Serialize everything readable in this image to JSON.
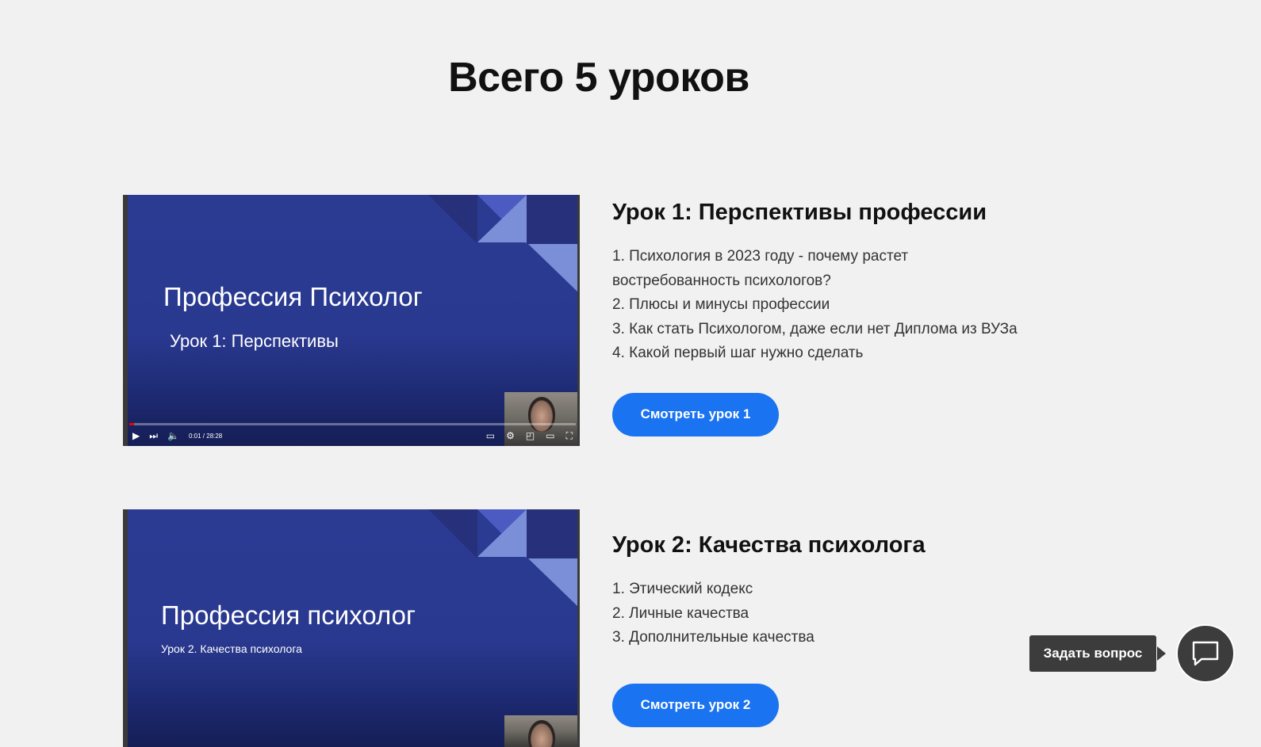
{
  "page": {
    "title": "Всего 5 уроков"
  },
  "lessons": [
    {
      "video": {
        "title": "Профессия Психолог",
        "subtitle": "Урок 1: Перспективы",
        "time": "0:01 / 28:28",
        "progress_fraction": 0.01
      },
      "title": "Урок 1: Перспективы профессии",
      "topics": [
        "1. Психология в 2023 году - почему растет",
        "востребованность психологов?",
        "2. Плюсы и минусы профессии",
        "3. Как стать Психологом, даже если нет Диплома из ВУЗа",
        "4. Какой первый шаг нужно сделать"
      ],
      "button": "Смотреть урок 1"
    },
    {
      "video": {
        "title": "Профессия психолог",
        "subtitle": "Урок 2. Качества психолога"
      },
      "title": "Урок 2: Качества психолога",
      "topics": [
        "1. Этический кодекс",
        "2. Личные качества",
        "3. Дополнительные качества"
      ],
      "button": "Смотреть урок 2"
    }
  ],
  "chat": {
    "label": "Задать вопрос",
    "icon": "chat-bubble-icon"
  },
  "colors": {
    "accent": "#1a73f0",
    "background": "#f1f1f1",
    "slide": "#2b3b92"
  }
}
